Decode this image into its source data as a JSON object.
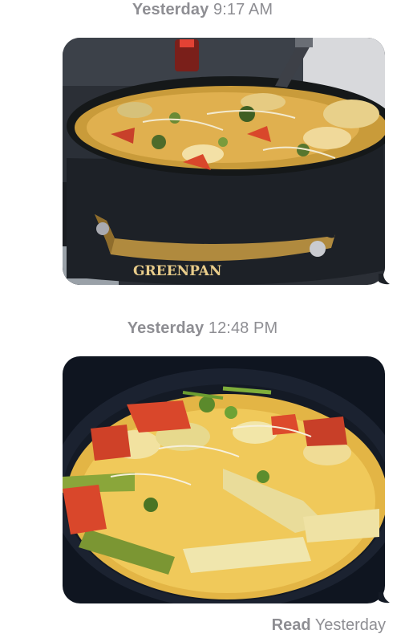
{
  "messages": [
    {
      "timestamp_day": "Yesterday",
      "timestamp_time": "9:17 AM",
      "image": {
        "subject": "pot-of-soup-photo",
        "brand_text": "GREENPAN"
      }
    },
    {
      "timestamp_day": "Yesterday",
      "timestamp_time": "12:48 PM",
      "image": {
        "subject": "pot-of-soup-photo"
      }
    }
  ],
  "receipt": {
    "status": "Read",
    "when": "Yesterday"
  },
  "colors": {
    "timestamp": "#8e8e93",
    "pot": "#1d2127",
    "broth": "#e3b545",
    "handle": "#b08a3e",
    "tomato": "#d9472b",
    "zucchini": "#8aa63a"
  }
}
